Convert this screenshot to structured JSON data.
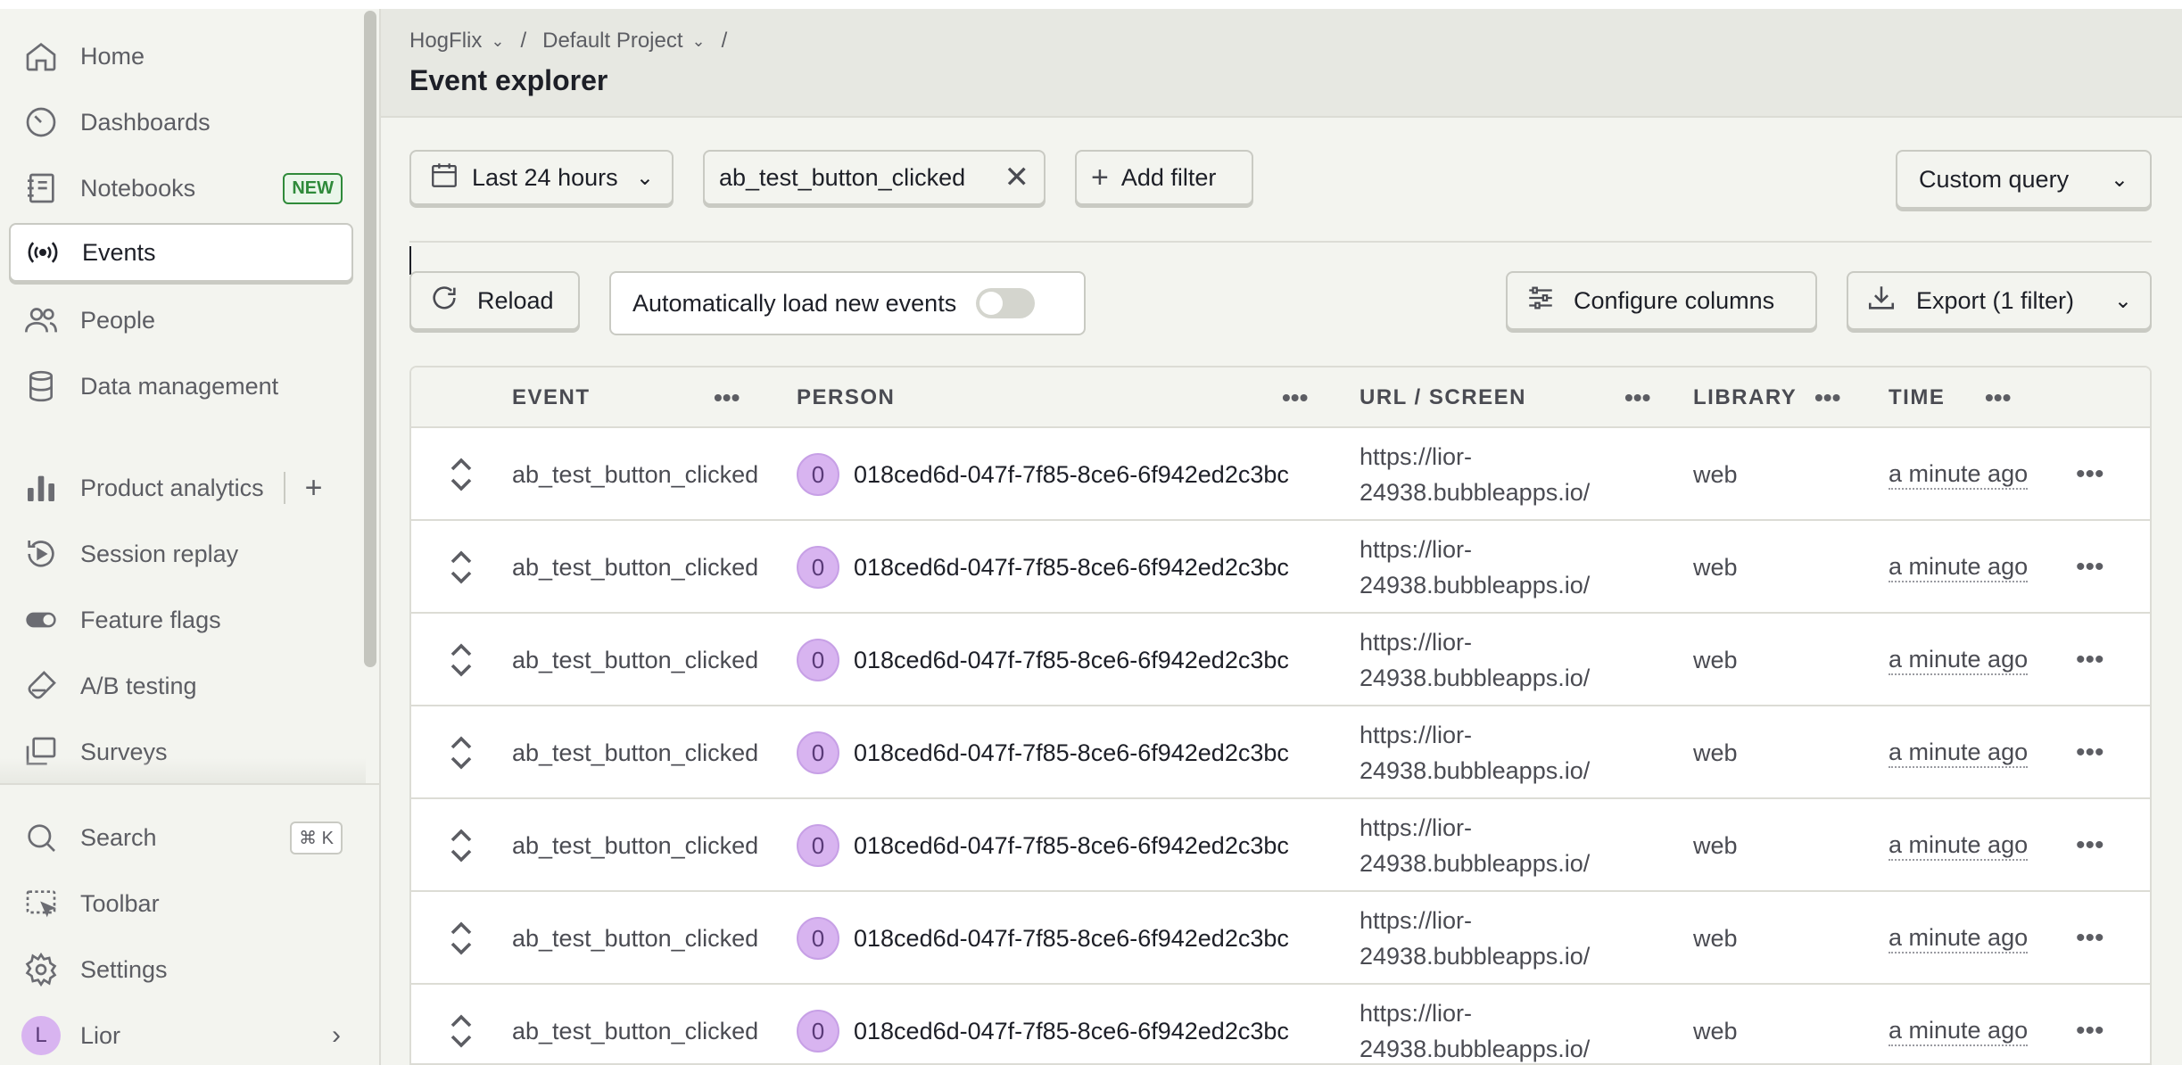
{
  "sidebar": {
    "items": [
      {
        "label": "Home",
        "icon": "home-icon"
      },
      {
        "label": "Dashboards",
        "icon": "dashboard-icon"
      },
      {
        "label": "Notebooks",
        "icon": "notebook-icon",
        "badge": "NEW"
      },
      {
        "label": "Events",
        "icon": "broadcast-icon",
        "active": true
      },
      {
        "label": "People",
        "icon": "people-icon"
      },
      {
        "label": "Data management",
        "icon": "database-icon"
      },
      {
        "label": "Product analytics",
        "icon": "bar-chart-icon"
      },
      {
        "label": "Session replay",
        "icon": "replay-icon"
      },
      {
        "label": "Feature flags",
        "icon": "toggle-icon"
      },
      {
        "label": "A/B testing",
        "icon": "flask-icon"
      },
      {
        "label": "Surveys",
        "icon": "survey-icon"
      }
    ],
    "add_label": "+",
    "bottom": {
      "search": {
        "label": "Search",
        "shortcut": "⌘ K"
      },
      "toolbar": {
        "label": "Toolbar"
      },
      "settings": {
        "label": "Settings"
      },
      "user": {
        "label": "Lior",
        "initial": "L"
      }
    }
  },
  "header": {
    "breadcrumbs": [
      "HogFlix",
      "Default Project"
    ],
    "separator": "/",
    "title": "Event explorer"
  },
  "filters": {
    "date_range": "Last 24 hours",
    "event_filter": "ab_test_button_clicked",
    "add_filter": "Add filter",
    "query_mode": "Custom query"
  },
  "actions": {
    "reload": "Reload",
    "auto_load": "Automatically load new events",
    "auto_load_enabled": false,
    "configure_columns": "Configure columns",
    "export": "Export (1 filter)"
  },
  "table": {
    "columns": [
      "EVENT",
      "PERSON",
      "URL / SCREEN",
      "LIBRARY",
      "TIME"
    ],
    "rows": [
      {
        "event": "ab_test_button_clicked",
        "person_initial": "0",
        "person": "018ced6d-047f-7f85-8ce6-6f942ed2c3bc",
        "url_line1": "https://lior-",
        "url_line2": "24938.bubbleapps.io/",
        "library": "web",
        "time": "a minute ago"
      },
      {
        "event": "ab_test_button_clicked",
        "person_initial": "0",
        "person": "018ced6d-047f-7f85-8ce6-6f942ed2c3bc",
        "url_line1": "https://lior-",
        "url_line2": "24938.bubbleapps.io/",
        "library": "web",
        "time": "a minute ago"
      },
      {
        "event": "ab_test_button_clicked",
        "person_initial": "0",
        "person": "018ced6d-047f-7f85-8ce6-6f942ed2c3bc",
        "url_line1": "https://lior-",
        "url_line2": "24938.bubbleapps.io/",
        "library": "web",
        "time": "a minute ago"
      },
      {
        "event": "ab_test_button_clicked",
        "person_initial": "0",
        "person": "018ced6d-047f-7f85-8ce6-6f942ed2c3bc",
        "url_line1": "https://lior-",
        "url_line2": "24938.bubbleapps.io/",
        "library": "web",
        "time": "a minute ago"
      },
      {
        "event": "ab_test_button_clicked",
        "person_initial": "0",
        "person": "018ced6d-047f-7f85-8ce6-6f942ed2c3bc",
        "url_line1": "https://lior-",
        "url_line2": "24938.bubbleapps.io/",
        "library": "web",
        "time": "a minute ago"
      },
      {
        "event": "ab_test_button_clicked",
        "person_initial": "0",
        "person": "018ced6d-047f-7f85-8ce6-6f942ed2c3bc",
        "url_line1": "https://lior-",
        "url_line2": "24938.bubbleapps.io/",
        "library": "web",
        "time": "a minute ago"
      },
      {
        "event": "ab_test_button_clicked",
        "person_initial": "0",
        "person": "018ced6d-047f-7f85-8ce6-6f942ed2c3bc",
        "url_line1": "https://lior-",
        "url_line2": "24938.bubbleapps.io/",
        "library": "web",
        "time": "a minute ago"
      }
    ]
  },
  "colors": {
    "background": "#f3f4ef",
    "header_bg": "#e7e8e2",
    "badge_green": "#2f8a3a",
    "avatar_purple": "#d8b4f0"
  }
}
